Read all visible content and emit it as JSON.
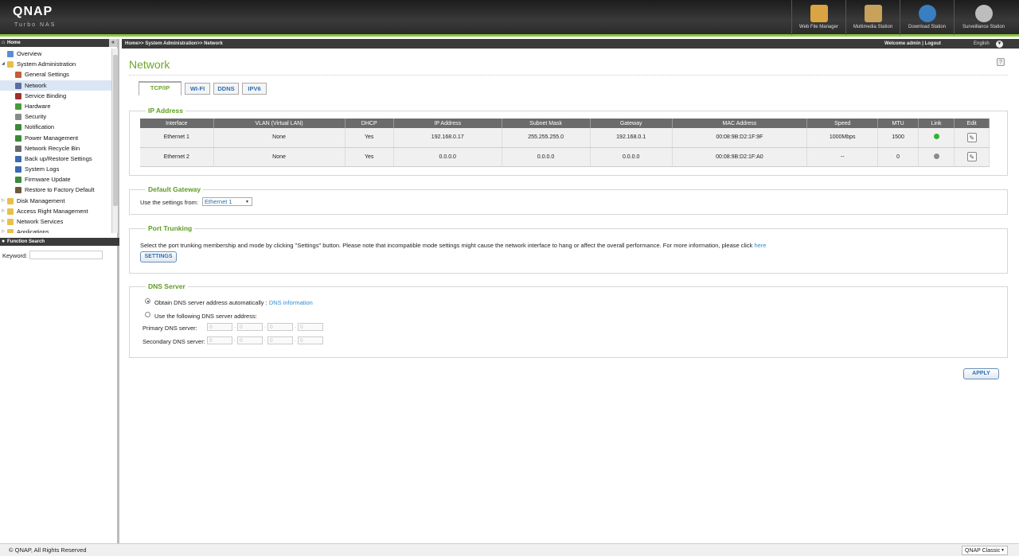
{
  "header": {
    "logo": "QNAP",
    "sublogo": "Turbo NAS",
    "apps": [
      {
        "label": "Web File Manager",
        "icon": "folder-globe-icon",
        "color": "#d9a441"
      },
      {
        "label": "Multimedia Station",
        "icon": "clapperboard-icon",
        "color": "#c8a25a"
      },
      {
        "label": "Download Station",
        "icon": "globe-download-icon",
        "color": "#3a7ec2"
      },
      {
        "label": "Surveillance Station",
        "icon": "camera-dome-icon",
        "color": "#bdbdbd"
      }
    ]
  },
  "topbar": {
    "breadcrumb": "Home>> System Administration>> Network",
    "welcome": "Welcome admin | Logout",
    "language": "English"
  },
  "sidebar": {
    "home_label": "Home",
    "items": [
      {
        "label": "Overview",
        "level": 1,
        "icon": "overview-icon",
        "color": "#5a8fd0",
        "selected": false
      },
      {
        "label": "System Administration",
        "level": 0,
        "icon": "folder-open-icon",
        "color": "#e8c04a",
        "expanded": true,
        "selected": false
      },
      {
        "label": "General Settings",
        "level": 2,
        "icon": "settings-icon",
        "color": "#c0603a",
        "selected": false
      },
      {
        "label": "Network",
        "level": 2,
        "icon": "network-icon",
        "color": "#5a6fa0",
        "selected": true
      },
      {
        "label": "Service Binding",
        "level": 2,
        "icon": "service-binding-icon",
        "color": "#a03030",
        "selected": false
      },
      {
        "label": "Hardware",
        "level": 2,
        "icon": "hardware-icon",
        "color": "#4a9a3a",
        "selected": false
      },
      {
        "label": "Security",
        "level": 2,
        "icon": "lock-icon",
        "color": "#8a8a8a",
        "selected": false
      },
      {
        "label": "Notification",
        "level": 2,
        "icon": "notification-icon",
        "color": "#3a8a3a",
        "selected": false
      },
      {
        "label": "Power Management",
        "level": 2,
        "icon": "power-icon",
        "color": "#3a8a3a",
        "selected": false
      },
      {
        "label": "Network Recycle Bin",
        "level": 2,
        "icon": "recycle-bin-icon",
        "color": "#6a6a6a",
        "selected": false
      },
      {
        "label": "Back up/Restore Settings",
        "level": 2,
        "icon": "backup-icon",
        "color": "#3a6ab0",
        "selected": false
      },
      {
        "label": "System Logs",
        "level": 2,
        "icon": "logs-icon",
        "color": "#3a6ab0",
        "selected": false
      },
      {
        "label": "Firmware Update",
        "level": 2,
        "icon": "firmware-icon",
        "color": "#3a8a3a",
        "selected": false
      },
      {
        "label": "Restore to Factory Default",
        "level": 2,
        "icon": "restore-icon",
        "color": "#6a5a3a",
        "selected": false
      },
      {
        "label": "Disk Management",
        "level": 0,
        "icon": "folder-icon",
        "color": "#e8c04a",
        "expanded": false,
        "selected": false
      },
      {
        "label": "Access Right Management",
        "level": 0,
        "icon": "folder-icon",
        "color": "#e8c04a",
        "expanded": false,
        "selected": false
      },
      {
        "label": "Network Services",
        "level": 0,
        "icon": "folder-icon",
        "color": "#e8c04a",
        "expanded": false,
        "selected": false
      },
      {
        "label": "Applications",
        "level": 0,
        "icon": "folder-icon",
        "color": "#e8c04a",
        "expanded": false,
        "selected": false
      }
    ],
    "function_search": {
      "title": "Function Search",
      "keyword_label": "Keyword:",
      "keyword_value": ""
    }
  },
  "main": {
    "title": "Network",
    "tabs": [
      {
        "label": "TCP/IP",
        "active": true
      },
      {
        "label": "WI-FI",
        "active": false
      },
      {
        "label": "DDNS",
        "active": false
      },
      {
        "label": "IPV6",
        "active": false
      }
    ],
    "ip_section": {
      "title": "IP Address",
      "columns": [
        "Interface",
        "VLAN (Virtual LAN)",
        "DHCP",
        "IP Address",
        "Subnet Mask",
        "Gateway",
        "MAC Address",
        "Speed",
        "MTU",
        "Link",
        "Edit"
      ],
      "rows": [
        {
          "interface": "Ethernet 1",
          "vlan": "None",
          "dhcp": "Yes",
          "ip": "192.168.0.17",
          "mask": "255.255.255.0",
          "gateway": "192.168.0.1",
          "mac": "00:08:9B:D2:1F:9F",
          "speed": "1000Mbps",
          "mtu": "1500",
          "link_color": "#2fb52f"
        },
        {
          "interface": "Ethernet 2",
          "vlan": "None",
          "dhcp": "Yes",
          "ip": "0.0.0.0",
          "mask": "0.0.0.0",
          "gateway": "0.0.0.0",
          "mac": "00:08:9B:D2:1F:A0",
          "speed": "--",
          "mtu": "0",
          "link_color": "#8a8a8a"
        }
      ]
    },
    "gateway_section": {
      "title": "Default Gateway",
      "label": "Use the settings from:",
      "value": "Ethernet 1"
    },
    "trunk_section": {
      "title": "Port Trunking",
      "description": "Select the port trunking membership and mode by clicking \"Settings\" button. Please note that incompatible mode settings might cause the network interface to hang or affect the overall performance. For more information, please click",
      "link": "here",
      "button": "SETTINGS"
    },
    "dns_section": {
      "title": "DNS Server",
      "auto_label": "Obtain DNS server address automatically :",
      "auto_link": "DNS information",
      "manual_label": "Use the following DNS server address:",
      "primary_label": "Primary DNS server:",
      "secondary_label": "Secondary DNS server:",
      "primary": [
        "0",
        "0",
        "0",
        "0"
      ],
      "secondary": [
        "0",
        "0",
        "0",
        "0"
      ],
      "selected": "auto"
    },
    "apply_button": "APPLY"
  },
  "footer": {
    "copyright": "© QNAP, All Rights Reserved",
    "theme": "QNAP Classic"
  }
}
